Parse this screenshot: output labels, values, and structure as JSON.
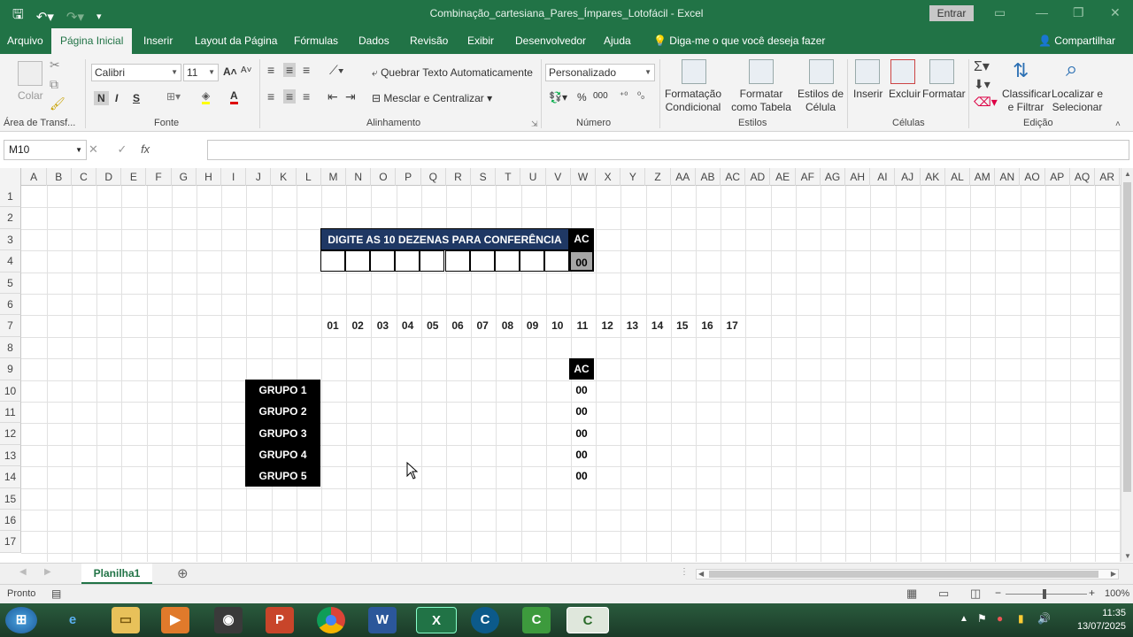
{
  "app": {
    "title": "Combinação_cartesiana_Pares_Ímpares_Lotofácil  -  Excel",
    "entrar": "Entrar"
  },
  "tabs": [
    "Arquivo",
    "Página Inicial",
    "Inserir",
    "Layout da Página",
    "Fórmulas",
    "Dados",
    "Revisão",
    "Exibir",
    "Desenvolvedor",
    "Ajuda"
  ],
  "tell_me": "Diga-me o que você deseja fazer",
  "share": "Compartilhar",
  "ribbon": {
    "clipboard": {
      "paste": "Colar",
      "label": "Área de Transf..."
    },
    "font": {
      "name": "Calibri",
      "size": "11",
      "label": "Fonte",
      "bold": "N",
      "italic": "I",
      "underline": "S"
    },
    "alignment": {
      "wrap": "Quebrar Texto Automaticamente",
      "merge": "Mesclar e Centralizar",
      "label": "Alinhamento"
    },
    "number": {
      "format": "Personalizado",
      "label": "Número"
    },
    "styles": {
      "conditional": "Formatação Condicional",
      "table": "Formatar como Tabela",
      "cell": "Estilos de Célula",
      "label": "Estilos"
    },
    "cells": {
      "insert": "Inserir",
      "delete": "Excluir",
      "format": "Formatar",
      "label": "Células"
    },
    "editing": {
      "sort": "Classificar e Filtrar",
      "find": "Localizar e Selecionar",
      "label": "Edição"
    }
  },
  "formula_bar": {
    "name_box": "M10",
    "formula": ""
  },
  "columns": [
    "A",
    "B",
    "C",
    "D",
    "E",
    "F",
    "G",
    "H",
    "I",
    "J",
    "K",
    "L",
    "M",
    "N",
    "O",
    "P",
    "Q",
    "R",
    "S",
    "T",
    "U",
    "V",
    "W",
    "X",
    "Y",
    "Z",
    "AA",
    "AB",
    "AC",
    "AD",
    "AE",
    "AF",
    "AG",
    "AH",
    "AI",
    "AJ",
    "AK",
    "AL",
    "AM",
    "AN",
    "AO",
    "AP",
    "AQ",
    "AR"
  ],
  "rows": [
    "1",
    "2",
    "3",
    "4",
    "5",
    "6",
    "7",
    "8",
    "9",
    "10",
    "11",
    "12",
    "13",
    "14",
    "15",
    "16",
    "17"
  ],
  "sheet": {
    "header_banner": "DIGITE AS 10 DEZENAS PARA CONFERÊNCIA",
    "ac_header": "AC",
    "ac_value": "00",
    "number_row": [
      "01",
      "02",
      "03",
      "04",
      "05",
      "06",
      "07",
      "08",
      "09",
      "10",
      "11",
      "12",
      "13",
      "14",
      "15",
      "16",
      "17"
    ],
    "ac_header2": "AC",
    "groups": [
      "GRUPO 1",
      "GRUPO 2",
      "GRUPO 3",
      "GRUPO 4",
      "GRUPO 5"
    ],
    "group_ac": [
      "00",
      "00",
      "00",
      "00",
      "00"
    ]
  },
  "sheet_tab": "Planilha1",
  "status": {
    "ready": "Pronto",
    "zoom": "100%"
  },
  "clock": {
    "time": "11:35",
    "date": "13/07/2025"
  },
  "colors": {
    "excel_green": "#217346",
    "banner_bg": "#1f3864",
    "black": "#000000"
  }
}
